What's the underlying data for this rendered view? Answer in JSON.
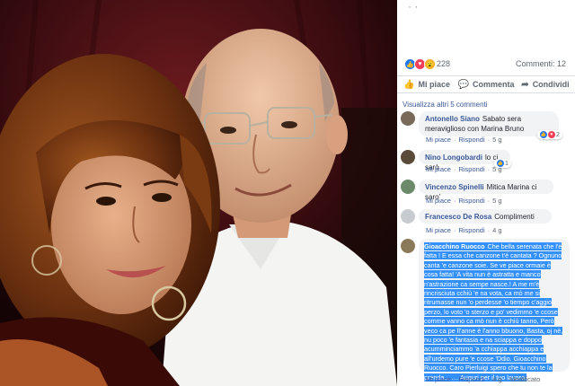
{
  "post": {
    "top_text": "· ·",
    "reaction_count": "228",
    "comment_count": "Commenti: 12",
    "reaction_icons": [
      "like-icon",
      "love-icon",
      "wow-icon"
    ]
  },
  "actions": {
    "like": "Mi piace",
    "comment": "Commenta",
    "share": "Condividi"
  },
  "view_previous": "Visualizza altri 5 commenti",
  "comments": [
    {
      "author": "Antonello Siano",
      "text": "Sabato sera meraviglioso con Marina Bruno",
      "like": "Mi piace",
      "reply": "Rispondi",
      "time": "5 g",
      "reactions": "2"
    },
    {
      "author": "Nino Longobardi",
      "text": "lo ci sarò",
      "like": "Mi piace",
      "reply": "Rispondi",
      "time": "5 g",
      "reactions": "1"
    },
    {
      "author": "Vincenzo Spinelli",
      "text": "Mitica Marina ci saro'",
      "like": "Mi piace",
      "reply": "Rispondi",
      "time": "5 g"
    },
    {
      "author": "Francesco De Rosa",
      "text": "Complimenti",
      "like": "Mi piace",
      "reply": "Rispondi",
      "time": "4 g"
    },
    {
      "author": "Gioacchino Ruocco",
      "text": "Che bella serenata che l'è fatta ! E essa che canzone t'é cantata ? Ognuno canta 'e canzone soie. Se ve piace ormaie è cosa fatta! 'A vita nun è astratta e manco n'astrazione ca sempe nasce.! A me m'è rincrisciuta cchiù 'e na vota, ca mò me si ritrumasse nun 'o perdesse 'o tiempo c'aggio perzo, lo voto 'o sterzo e po' vedimmo 'e ccose comme vanno ca mò nun è cchiù tanno, Però veco ca pe ll'anne è l'anno bbuono, Basta, oj nè, nu poco 'e fantasia e na sciappa e doppo acumminciammo 'a cchiappa acchiappa e all'urdemo pure 'e ccose 'Ddio. Gioacchino Ruocco. Caro Pierluigi spero che tu non te la prenda........ Auguri per il tuo lavoro.",
      "like": "Mi piace",
      "reply": "Rispondi",
      "time": "4 g",
      "edited": "Modificato"
    }
  ],
  "colors": {
    "link": "#385898",
    "like_blue": "#2078f4",
    "love_red": "#f33e58",
    "wow_yellow": "#f7b125",
    "selection": "#3390ff"
  }
}
